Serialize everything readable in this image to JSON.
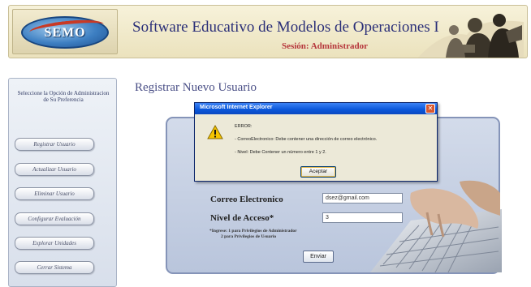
{
  "header": {
    "logo_text": "SEMO",
    "title": "Software Educativo de Modelos de Operaciones I",
    "subtitle": "Sesión: Administrador"
  },
  "sidebar": {
    "heading": "Seleccione la Opción de Administracion de Su Preferencia",
    "items": [
      {
        "label": "Registrar Usuario"
      },
      {
        "label": "Actualizar Usuario"
      },
      {
        "label": "Eliminar Usuario"
      },
      {
        "label": "Configurar Evaluación"
      },
      {
        "label": "Explorar Unidades"
      },
      {
        "label": "Cerrar Sistema"
      }
    ]
  },
  "main": {
    "title": "Registrar Nuevo Usuario",
    "form": {
      "email_label": "Correo Electronico",
      "email_value": "dsez@gmail.com",
      "access_label": "Nivel de Acceso*",
      "access_value": "3",
      "footnote_line1": "*Ingrese: 1 para Privilegios de Administrador",
      "footnote_line2": "2 para Privilegios de Usuario",
      "submit_label": "Enviar"
    }
  },
  "dialog": {
    "title": "Microsoft Internet Explorer",
    "heading": "ERROR:",
    "line1": "- CorreoElectronico: Debe contener una dirección de correo electrónico.",
    "line2": "- Nivel: Debe Contener un número entre 1 y 2.",
    "ok_label": "Aceptar",
    "close_glyph": "✕"
  },
  "colors": {
    "title_text": "#2b2f78",
    "subtitle_text": "#b5343a",
    "dialog_titlebar": "#0a56d9",
    "warning": "#f5c400"
  }
}
